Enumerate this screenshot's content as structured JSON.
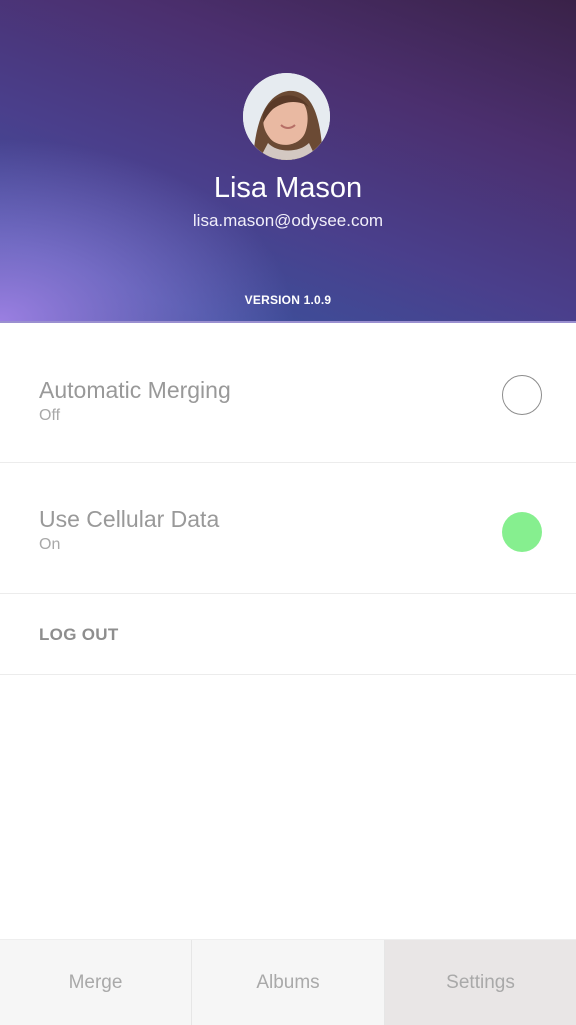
{
  "profile": {
    "name": "Lisa Mason",
    "email": "lisa.mason@odysee.com",
    "version": "VERSION 1.0.9"
  },
  "settings": {
    "automatic_merging": {
      "title": "Automatic Merging",
      "status": "Off",
      "enabled": false
    },
    "cellular_data": {
      "title": "Use Cellular Data",
      "status": "On",
      "enabled": true
    },
    "logout_label": "LOG OUT"
  },
  "tabs": [
    {
      "label": "Merge",
      "active": false
    },
    {
      "label": "Albums",
      "active": false
    },
    {
      "label": "Settings",
      "active": true
    }
  ],
  "colors": {
    "toggle_on": "#86ef8f",
    "header_gradient_start": "#a082e6",
    "header_gradient_end": "#33498f"
  }
}
